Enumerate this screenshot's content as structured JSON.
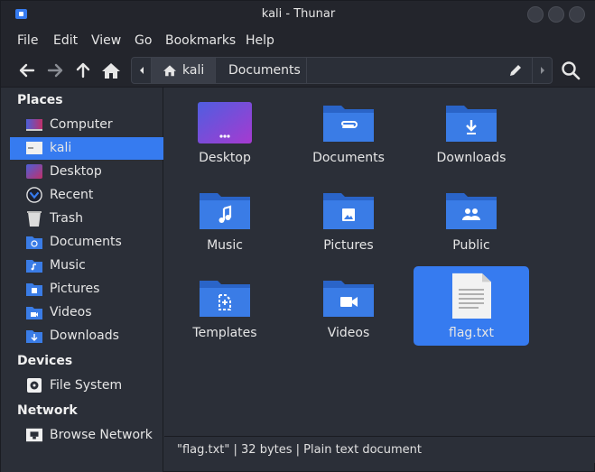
{
  "window": {
    "title": "kali - Thunar"
  },
  "menu": [
    "File",
    "Edit",
    "View",
    "Go",
    "Bookmarks",
    "Help"
  ],
  "toolbar": {
    "icons": [
      "back-arrow-icon",
      "forward-arrow-icon",
      "up-arrow-icon",
      "home-icon",
      "search-icon",
      "edit-pencil-icon"
    ],
    "path": [
      "kali",
      "Documents"
    ]
  },
  "sidebar": {
    "places_heading": "Places",
    "places": [
      "Computer",
      "kali",
      "Desktop",
      "Recent",
      "Trash",
      "Documents",
      "Music",
      "Pictures",
      "Videos",
      "Downloads"
    ],
    "selected": "kali",
    "devices_heading": "Devices",
    "devices": [
      "File System"
    ],
    "network_heading": "Network",
    "network": [
      "Browse Network"
    ]
  },
  "files": [
    {
      "name": "Desktop",
      "icon": "desktop-folder-icon"
    },
    {
      "name": "Documents",
      "icon": "documents-folder-icon"
    },
    {
      "name": "Downloads",
      "icon": "downloads-folder-icon"
    },
    {
      "name": "Music",
      "icon": "music-folder-icon"
    },
    {
      "name": "Pictures",
      "icon": "pictures-folder-icon"
    },
    {
      "name": "Public",
      "icon": "public-folder-icon"
    },
    {
      "name": "Templates",
      "icon": "templates-folder-icon"
    },
    {
      "name": "Videos",
      "icon": "videos-folder-icon"
    },
    {
      "name": "flag.txt",
      "icon": "text-file-icon"
    }
  ],
  "selected_file": "flag.txt",
  "status": "\"flag.txt\" | 32 bytes | Plain text document",
  "colors": {
    "accent": "#367bf0",
    "folder": "#3a7ce6",
    "background": "#2b2f38"
  }
}
